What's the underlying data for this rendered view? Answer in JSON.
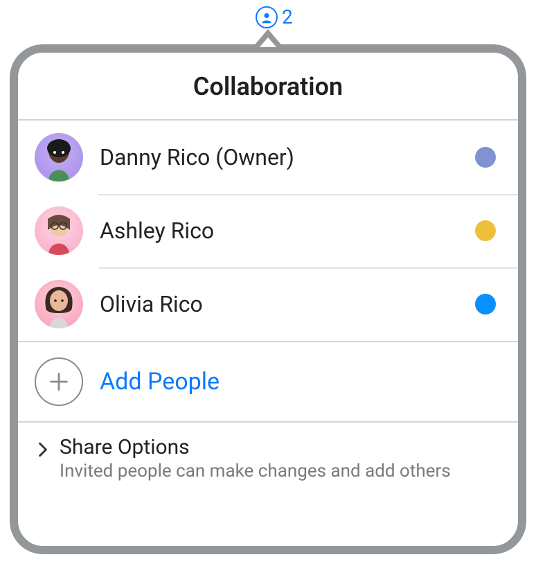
{
  "toolbar": {
    "collaborator_count": "2"
  },
  "popover": {
    "title": "Collaboration",
    "people": [
      {
        "name": "Danny Rico (Owner)",
        "dot_color": "#7f93d1",
        "avatar_key": "danny"
      },
      {
        "name": "Ashley Rico",
        "dot_color": "#eec03a",
        "avatar_key": "ashley"
      },
      {
        "name": "Olivia Rico",
        "dot_color": "#0a8fff",
        "avatar_key": "olivia"
      }
    ],
    "add_people_label": "Add People",
    "share_options": {
      "title": "Share Options",
      "subtitle": "Invited people can make changes and add others"
    }
  }
}
